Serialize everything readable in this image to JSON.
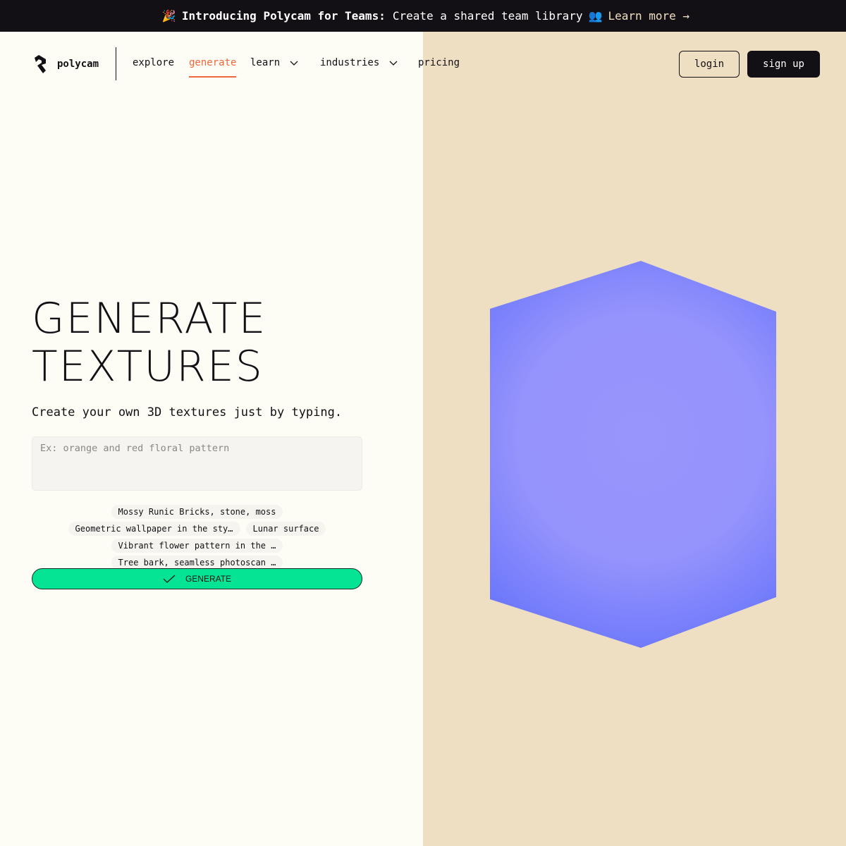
{
  "banner": {
    "emoji": "🎉",
    "bold": "Introducing Polycam for Teams:",
    "text": "Create a shared team library",
    "emoji2": "👥",
    "link": "Learn more →"
  },
  "nav": {
    "brand": "polycam",
    "items": [
      {
        "label": "explore",
        "active": false,
        "dropdown": false
      },
      {
        "label": "generate",
        "active": true,
        "dropdown": false
      },
      {
        "label": "learn",
        "active": false,
        "dropdown": true
      },
      {
        "label": "industries",
        "active": false,
        "dropdown": true
      },
      {
        "label": "pricing",
        "active": false,
        "dropdown": false
      }
    ],
    "login_label": "login",
    "signup_label": "sign up"
  },
  "hero": {
    "title_line1": "GENERATE",
    "title_line2": "TEXTURES",
    "subtitle": "Create your own 3D textures just by typing.",
    "prompt_value": "",
    "prompt_placeholder": "Ex: orange and red floral pattern",
    "suggestions": [
      "Mossy Runic Bricks, stone, moss",
      "Geometric wallpaper in the sty…",
      "Lunar surface",
      "Vibrant flower pattern in the …",
      "Tree bark, seamless photoscan …"
    ],
    "generate_label": "GENERATE"
  },
  "colors": {
    "accent": "#f0663b",
    "generate_green": "#04e494",
    "dark": "#121015",
    "right_panel": "#efdfc2",
    "texture_edge": "#6a76fb",
    "texture_center": "#9896fc"
  }
}
